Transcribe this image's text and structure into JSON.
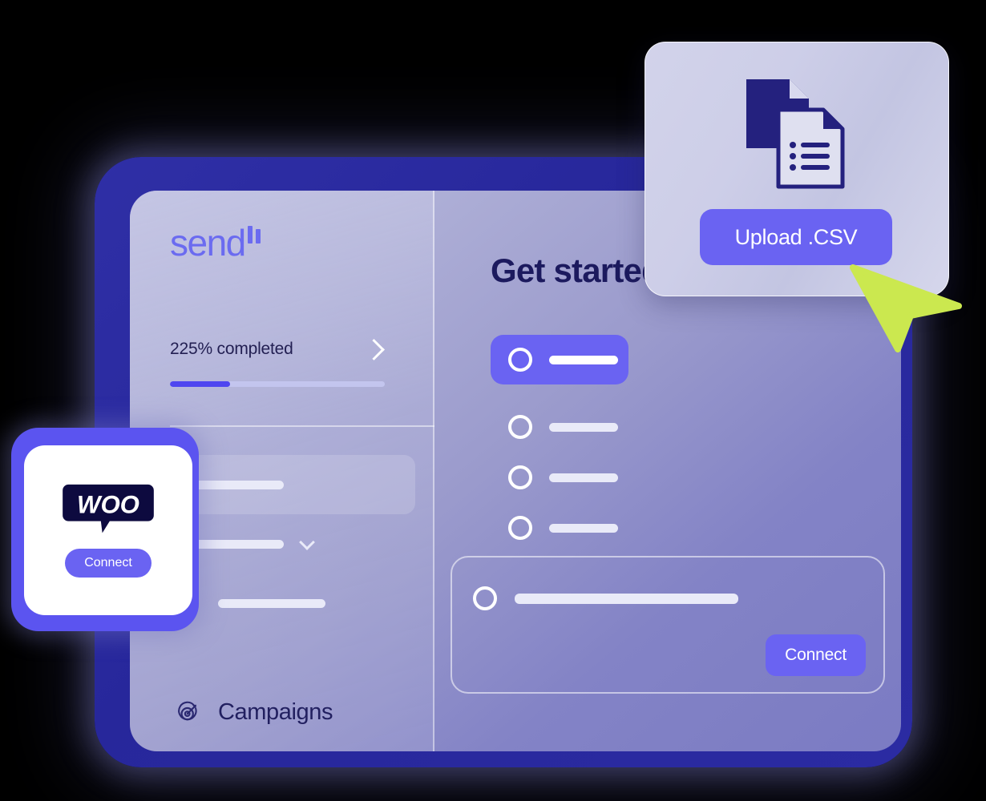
{
  "app": {
    "brand_name": "send",
    "brand_mark": "double-tick"
  },
  "sidebar": {
    "progress": {
      "label": "225% completed",
      "percent_filled": 28,
      "chevron": "chevron-right-icon"
    },
    "nav_items": [
      {
        "label": "",
        "icon": "",
        "state": "active",
        "placeholder": true
      },
      {
        "label": "",
        "icon": "",
        "state": "default",
        "placeholder": true,
        "expandable": true
      },
      {
        "label": "",
        "icon": "message-card-icon",
        "state": "default",
        "placeholder": true
      },
      {
        "label": "Campaigns",
        "icon": "target-arrow-icon",
        "state": "default",
        "placeholder": false
      }
    ]
  },
  "main": {
    "title": "Get started",
    "checklist": [
      {
        "state": "active",
        "placeholder": true
      },
      {
        "state": "default",
        "placeholder": true
      },
      {
        "state": "default",
        "placeholder": true
      },
      {
        "state": "default",
        "placeholder": true
      }
    ],
    "connect_panel": {
      "button_label": "Connect",
      "placeholder": true
    }
  },
  "csv_card": {
    "icon": "documents-csv-icon",
    "button_label": "Upload .CSV"
  },
  "woo_card": {
    "logo": "woocommerce-logo",
    "logo_text": "WOO",
    "button_label": "Connect"
  },
  "cursor": {
    "type": "pointer-arrow",
    "color": "#cbe84f"
  },
  "colors": {
    "accent": "#6a63f2",
    "accent_strong": "#4f46f0",
    "frame_border": "#2b2ba2",
    "title_navy": "#1c1a5e",
    "panel_light": "#b9bade",
    "panel_dark": "#7b7bc3",
    "cursor_green": "#cbe84f",
    "woo_navy": "#0d0a3f"
  }
}
